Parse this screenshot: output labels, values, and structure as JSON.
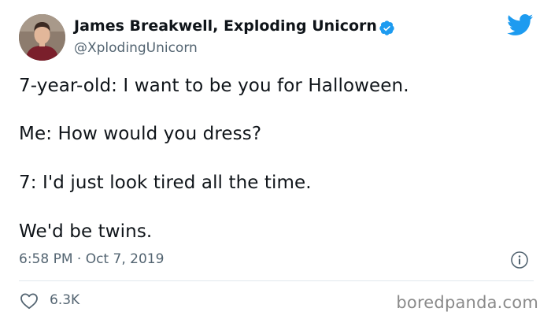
{
  "author": {
    "name": "James Breakwell, Exploding Unicorn",
    "handle": "@XplodingUnicorn",
    "avatar_icon": "user-photo",
    "verified_icon": "verified-badge-icon",
    "verified_color": "#1d9bf0"
  },
  "brand": {
    "icon": "twitter-bird-icon",
    "color": "#1d9bf0"
  },
  "tweet": {
    "lines": [
      "7-year-old: I want to be you for Halloween.",
      "Me: How would you dress?",
      "7: I'd just look tired all the time.",
      "We'd be twins."
    ],
    "timestamp": "6:58 PM · Oct 7, 2019",
    "info_icon": "info-icon"
  },
  "engagement": {
    "like_icon": "heart-icon",
    "likes": "6.3K"
  },
  "watermark": "boredpanda.com",
  "colors": {
    "text": "#0f1419",
    "secondary": "#536471",
    "divider": "#e1e8ed"
  }
}
